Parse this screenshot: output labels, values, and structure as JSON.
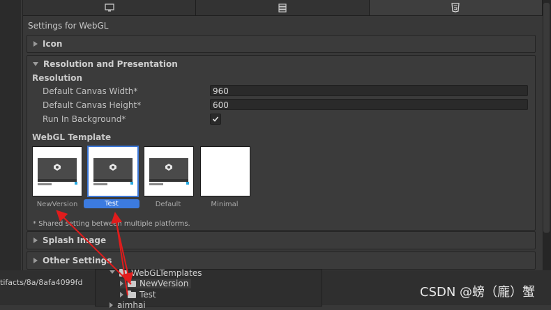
{
  "colors": {
    "accent": "#3c7be0",
    "annotation_arrow": "#e01c1c",
    "panel_bg": "#383838"
  },
  "tabs": [
    {
      "icon": "monitor-icon"
    },
    {
      "icon": "server-icon"
    },
    {
      "icon": "html5-icon"
    }
  ],
  "settings_title": "Settings for WebGL",
  "sections": {
    "icon": "Icon",
    "resolution": "Resolution and Presentation",
    "splash": "Splash Image",
    "other": "Other Settings"
  },
  "resolution": {
    "heading": "Resolution",
    "canvas_width_label": "Default Canvas Width*",
    "canvas_width_value": "960",
    "canvas_height_label": "Default Canvas Height*",
    "canvas_height_value": "600",
    "run_in_background_label": "Run In Background*",
    "run_in_background_checked": true
  },
  "webgl_template": {
    "heading": "WebGL Template",
    "templates": [
      {
        "name": "NewVersion",
        "selected": false,
        "thumbnail": "unity-logo-preview"
      },
      {
        "name": "Test",
        "selected": true,
        "thumbnail": "unity-logo-preview"
      },
      {
        "name": "Default",
        "selected": false,
        "thumbnail": "unity-logo-preview"
      },
      {
        "name": "Minimal",
        "selected": false,
        "thumbnail": "blank"
      }
    ],
    "note": "* Shared setting between multiple platforms."
  },
  "bottom": {
    "path_text": "tifacts/8a/8afa4099fd",
    "tree": [
      {
        "label": "WebGLTemplates"
      },
      {
        "label": "NewVersion"
      },
      {
        "label": "Test"
      },
      {
        "label": "aimhai"
      }
    ]
  },
  "watermark": "CSDN @螃（龐）蟹"
}
